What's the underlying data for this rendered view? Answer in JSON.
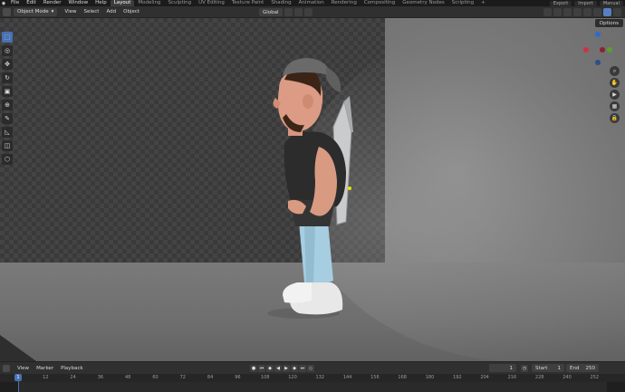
{
  "menubar": {
    "items": [
      "File",
      "Edit",
      "Render",
      "Window",
      "Help"
    ],
    "workspaces": [
      "Layout",
      "Modeling",
      "Sculpting",
      "UV Editing",
      "Texture Paint",
      "Shading",
      "Animation",
      "Rendering",
      "Compositing",
      "Geometry Nodes",
      "Scripting"
    ],
    "active_workspace": "Layout",
    "add_tab": "+",
    "export_label": "Export",
    "import_label": "Import",
    "manual_label": "Manual"
  },
  "viewport_header": {
    "mode": "Object Mode",
    "menus": [
      "View",
      "Select",
      "Add",
      "Object"
    ],
    "orientation": "Global"
  },
  "viewport": {
    "options_label": "Options",
    "gizmo_axes": [
      "Z",
      "X",
      "Y"
    ],
    "accent": "#4772b3"
  },
  "timeline": {
    "menus": [
      "View",
      "Marker",
      "Playback"
    ],
    "current_frame": "1",
    "start_label": "Start",
    "start_value": "1",
    "end_label": "End",
    "end_value": "250",
    "ticks": [
      "1",
      "12",
      "24",
      "36",
      "48",
      "60",
      "72",
      "84",
      "96",
      "108",
      "120",
      "132",
      "144",
      "156",
      "168",
      "180",
      "192",
      "204",
      "216",
      "228",
      "240",
      "252"
    ],
    "playhead_label": "1"
  }
}
